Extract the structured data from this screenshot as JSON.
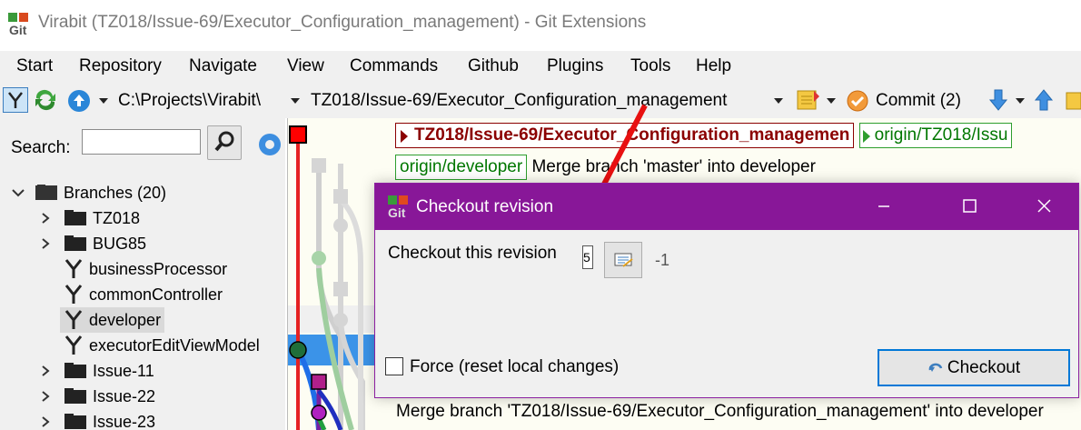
{
  "window": {
    "title": "Virabit (TZ018/Issue-69/Executor_Configuration_management) - Git Extensions"
  },
  "menu": [
    "Start",
    "Repository",
    "Navigate",
    "View",
    "Commands",
    "Github",
    "Plugins",
    "Tools",
    "Help"
  ],
  "toolbar": {
    "path": "C:\\Projects\\Virabit\\",
    "branch": "TZ018/Issue-69/Executor_Configuration_management",
    "commit_label": "Commit (2)"
  },
  "left_panel": {
    "search_label": "Search:",
    "search_value": "",
    "tree": [
      {
        "label": "Branches (20)",
        "type": "root",
        "expanded": true
      },
      {
        "label": "TZ018",
        "type": "folder"
      },
      {
        "label": "BUG85",
        "type": "folder"
      },
      {
        "label": "businessProcessor",
        "type": "branch"
      },
      {
        "label": "commonController",
        "type": "branch"
      },
      {
        "label": "developer",
        "type": "branch",
        "selected": true
      },
      {
        "label": "executorEditViewModel",
        "type": "branch"
      },
      {
        "label": "Issue-11",
        "type": "folder"
      },
      {
        "label": "Issue-22",
        "type": "folder"
      },
      {
        "label": "Issue-23",
        "type": "folder"
      }
    ]
  },
  "revisions": {
    "head_ref": "TZ018/Issue-69/Executor_Configuration_managemen",
    "head_remote_ref": "origin/TZ018/Issu",
    "row2_ref": "origin/developer",
    "row2_message": "Merge branch 'master' into developer",
    "bottom_message": "Merge branch 'TZ018/Issue-69/Executor_Configuration_management' into developer"
  },
  "dialog": {
    "title": "Checkout revision",
    "label": "Checkout this revision",
    "revision_value": "5",
    "count": "-1",
    "force_label": "Force (reset local changes)",
    "force_checked": false,
    "checkout_button": "Checkout",
    "colors": {
      "titlebar": "#881798"
    }
  }
}
